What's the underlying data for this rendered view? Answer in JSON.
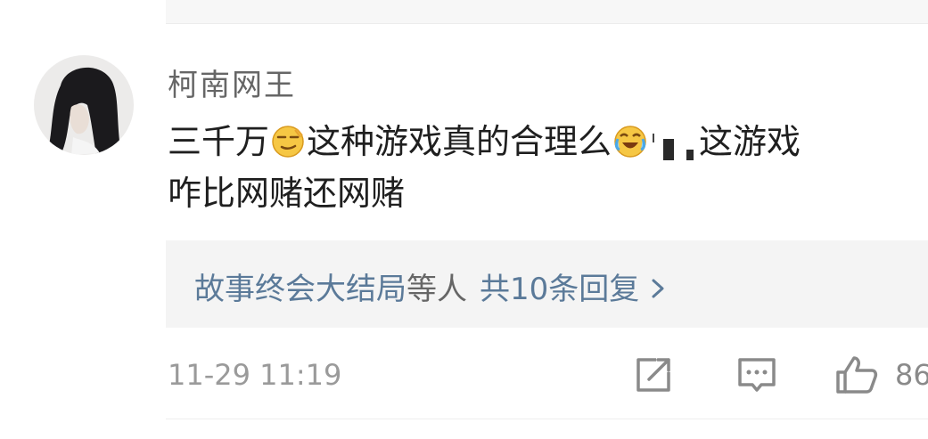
{
  "comment": {
    "username": "柯南网王",
    "text_part1": "三千万",
    "text_part2": "这种游戏真的合理么",
    "text_part3": "这游戏",
    "text_line2": "咋比网赌还网赌",
    "emoji1": "smirk-emoji",
    "emoji2": "laugh-cry-emoji"
  },
  "replies": {
    "users": "故事终会大结局",
    "suffix": "等人",
    "count_label": "共10条回复"
  },
  "meta": {
    "timestamp": "11-29 11:19",
    "like_count": "86"
  },
  "colors": {
    "link": "#5b7a99",
    "muted": "#9a9a9a",
    "reply_bg": "#f4f4f4"
  },
  "icons": {
    "share": "share-icon",
    "comment": "comment-icon",
    "like": "like-icon",
    "chevron": "chevron-right-icon"
  }
}
